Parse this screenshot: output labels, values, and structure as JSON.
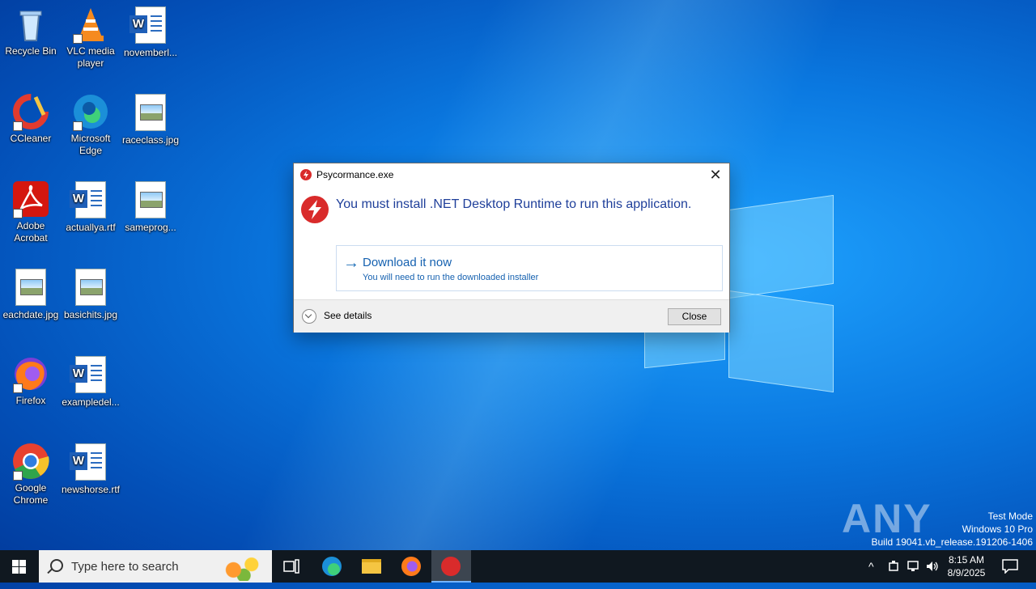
{
  "desktop": {
    "icons": [
      {
        "label": "Recycle Bin"
      },
      {
        "label": "VLC media player"
      },
      {
        "label": "novemberl..."
      },
      {
        "label": "CCleaner"
      },
      {
        "label": "Microsoft Edge"
      },
      {
        "label": "raceclass.jpg"
      },
      {
        "label": "Adobe Acrobat"
      },
      {
        "label": "actuallya.rtf"
      },
      {
        "label": "sameprog..."
      },
      {
        "label": "eachdate.jpg"
      },
      {
        "label": "basichits.jpg"
      },
      {
        "label": "Firefox"
      },
      {
        "label": "exampledel..."
      },
      {
        "label": "Google Chrome"
      },
      {
        "label": "newshorse.rtf"
      }
    ]
  },
  "dialog": {
    "title": "Psycormance.exe",
    "close_glyph": "✕",
    "headline": "You must install .NET Desktop Runtime to run this application.",
    "command_link": {
      "arrow_glyph": "→",
      "label": "Download it now",
      "note": "You will need to run the downloaded installer"
    },
    "details_label": "See details",
    "close_button": "Close",
    "accent_color": "#d92b2b"
  },
  "watermark": {
    "brand": "ANY RUN",
    "line1": "Test Mode",
    "line2": "Windows 10 Pro",
    "line3": "Build 19041.vb_release.191206-1406"
  },
  "taskbar": {
    "search_placeholder": "Type here to search",
    "time": "8:15 AM",
    "date": "8/9/2025",
    "tray_chevron": "^"
  }
}
